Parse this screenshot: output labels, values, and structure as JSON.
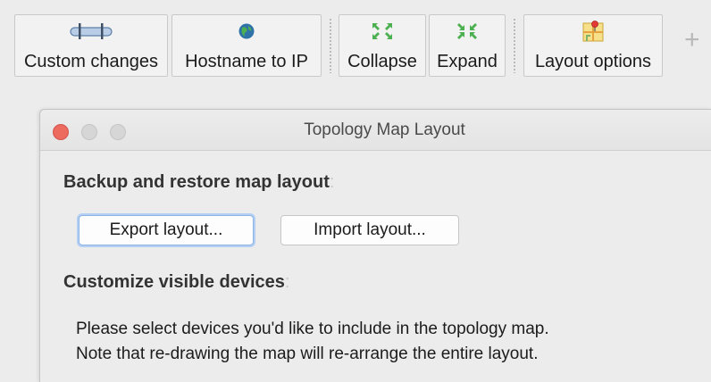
{
  "toolbar": {
    "buttons": [
      {
        "label": "Custom changes",
        "icon": "cable-icon"
      },
      {
        "label": "Hostname to IP",
        "icon": "globe-icon"
      },
      {
        "label": "Collapse",
        "icon": "collapse-arrows-icon"
      },
      {
        "label": "Expand",
        "icon": "expand-arrows-icon"
      },
      {
        "label": "Layout options",
        "icon": "map-pin-icon"
      }
    ],
    "overflow_icon": "plus-icon"
  },
  "dialog": {
    "title": "Topology Map Layout",
    "section1": {
      "heading": "Backup and restore map layout",
      "colon": ":"
    },
    "export_button": "Export layout...",
    "import_button": "Import layout...",
    "section2": {
      "heading": "Customize visible devices",
      "colon": ":"
    },
    "description_line1": "Please select devices you'd like to include in the topology map.",
    "description_line2": "Note that re-drawing the map will re-arrange the entire layout."
  },
  "colors": {
    "close_light": "#ed6a5e",
    "inactive_light": "#d6d6d6",
    "icon_green": "#4caf50",
    "focus_ring": "#b3d0f4"
  }
}
